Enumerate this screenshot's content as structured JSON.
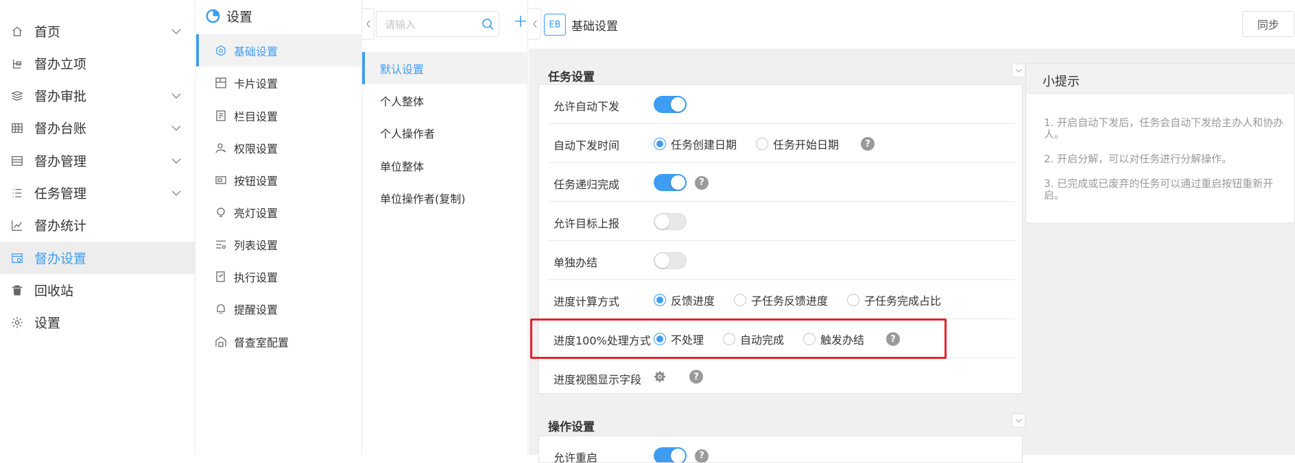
{
  "nav": {
    "items": [
      {
        "label": "首页",
        "icon": "home-icon",
        "chevron": true
      },
      {
        "label": "督办立项",
        "icon": "project-icon",
        "chevron": false
      },
      {
        "label": "督办审批",
        "icon": "approval-icon",
        "chevron": true
      },
      {
        "label": "督办台账",
        "icon": "ledger-icon",
        "chevron": true
      },
      {
        "label": "督办管理",
        "icon": "manage-icon",
        "chevron": true
      },
      {
        "label": "任务管理",
        "icon": "list-icon",
        "chevron": true
      },
      {
        "label": "督办统计",
        "icon": "chart-icon",
        "chevron": false
      },
      {
        "label": "督办设置",
        "icon": "settings-panel-icon",
        "chevron": false,
        "active": true
      },
      {
        "label": "回收站",
        "icon": "trash-icon",
        "chevron": false
      },
      {
        "label": "设置",
        "icon": "gear-icon",
        "chevron": false
      }
    ]
  },
  "settings_panel": {
    "title": "设置",
    "items": [
      {
        "label": "基础设置",
        "active": true
      },
      {
        "label": "卡片设置"
      },
      {
        "label": "栏目设置"
      },
      {
        "label": "权限设置"
      },
      {
        "label": "按钮设置"
      },
      {
        "label": "亮灯设置"
      },
      {
        "label": "列表设置"
      },
      {
        "label": "执行设置"
      },
      {
        "label": "提醒设置"
      },
      {
        "label": "督查室配置"
      }
    ]
  },
  "preset_panel": {
    "search_placeholder": "请输入",
    "items": [
      {
        "label": "默认设置",
        "active": true
      },
      {
        "label": "个人整体"
      },
      {
        "label": "个人操作者"
      },
      {
        "label": "单位整体"
      },
      {
        "label": "单位操作者(复制)"
      }
    ]
  },
  "header": {
    "badge": "EB",
    "title": "基础设置",
    "sync_label": "同步"
  },
  "task_section": {
    "title": "任务设置",
    "rows": [
      {
        "label": "允许自动下发",
        "type": "switch",
        "on": true
      },
      {
        "label": "自动下发时间",
        "type": "radio",
        "options": [
          "任务创建日期",
          "任务开始日期"
        ],
        "selected": 0,
        "help": "?"
      },
      {
        "label": "任务递归完成",
        "type": "switch",
        "on": true,
        "help": "?"
      },
      {
        "label": "允许目标上报",
        "type": "switch",
        "on": false
      },
      {
        "label": "单独办结",
        "type": "switch",
        "on": false
      },
      {
        "label": "进度计算方式",
        "type": "radio",
        "options": [
          "反馈进度",
          "子任务反馈进度",
          "子任务完成占比"
        ],
        "selected": 0
      },
      {
        "label": "进度100%处理方式",
        "type": "radio",
        "options": [
          "不处理",
          "自动完成",
          "触发办结"
        ],
        "selected": 0,
        "help": "?"
      },
      {
        "label": "进度视图显示字段",
        "type": "gear",
        "help": "?"
      }
    ]
  },
  "op_section": {
    "title": "操作设置",
    "rows": [
      {
        "label": "允许重启",
        "type": "switch",
        "on": true,
        "help": "?"
      }
    ]
  },
  "tips": {
    "title": "小提示",
    "lines": [
      "1. 开启自动下发后，任务会自动下发给主办人和协办人。",
      "2. 开启分解，可以对任务进行分解操作。",
      "3. 已完成或已废弃的任务可以通过重启按钮重新开启。"
    ]
  },
  "colors": {
    "accent": "#3d9df2",
    "highlight_border": "#e8202a"
  }
}
